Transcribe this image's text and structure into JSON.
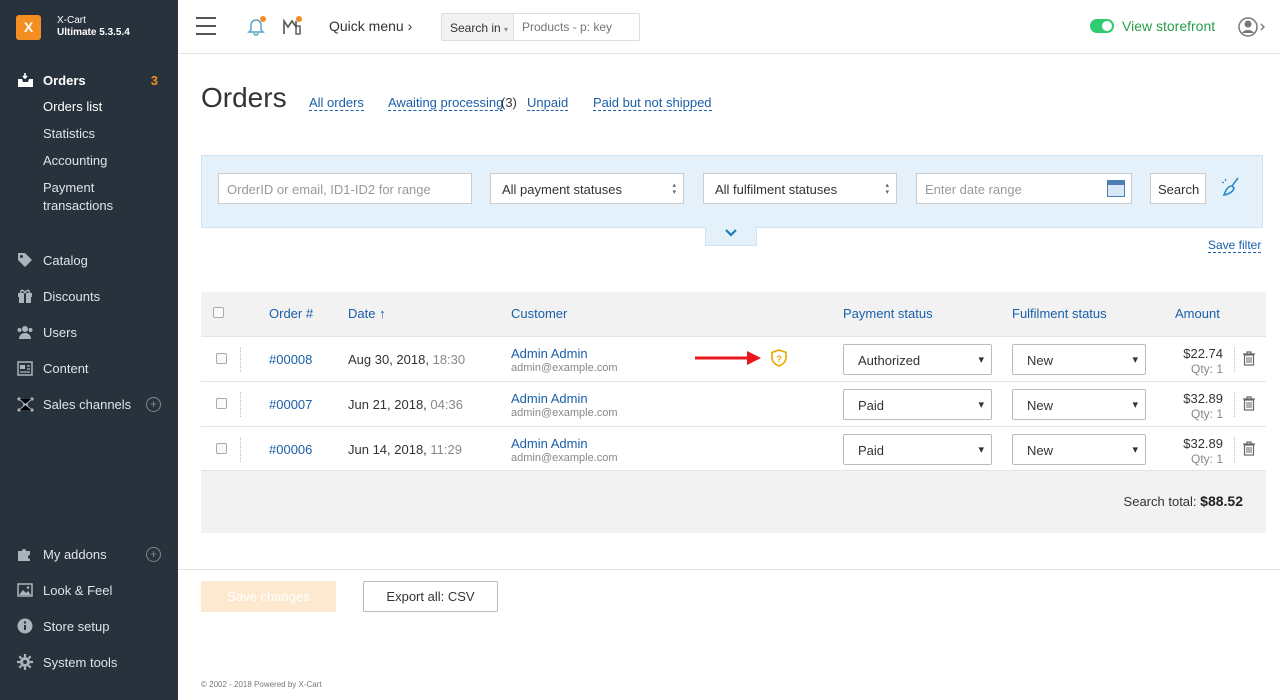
{
  "brand": {
    "line1": "X-Cart",
    "line2": "Ultimate 5.3.5.4",
    "logo_glyph": "X"
  },
  "sidebar": {
    "orders": {
      "label": "Orders",
      "badge": "3"
    },
    "orders_sub": [
      "Orders list",
      "Statistics",
      "Accounting",
      "Payment transactions"
    ],
    "items": [
      {
        "label": "Catalog",
        "icon": "tag-icon"
      },
      {
        "label": "Discounts",
        "icon": "gift-icon"
      },
      {
        "label": "Users",
        "icon": "users-icon"
      },
      {
        "label": "Content",
        "icon": "content-icon"
      },
      {
        "label": "Sales channels",
        "icon": "network-icon"
      }
    ],
    "bottom_items": [
      {
        "label": "My addons",
        "icon": "puzzle-icon"
      },
      {
        "label": "Look & Feel",
        "icon": "image-icon"
      },
      {
        "label": "Store setup",
        "icon": "info-icon"
      },
      {
        "label": "System tools",
        "icon": "gear-icon"
      }
    ]
  },
  "topbar": {
    "quick_menu": "Quick menu",
    "search_in": "Search in",
    "search_placeholder": "Products - p: key",
    "view_storefront": "View storefront"
  },
  "page": {
    "title": "Orders",
    "quick_links": [
      "All orders",
      "Awaiting processing",
      "Unpaid",
      "Paid but not shipped"
    ],
    "awaiting_count": "(3)"
  },
  "filter": {
    "order_placeholder": "OrderID or email, ID1-ID2 for range",
    "payment_status": "All payment statuses",
    "fulfilment_status": "All fulfilment statuses",
    "date_placeholder": "Enter date range",
    "search_label": "Search",
    "save_filter": "Save filter"
  },
  "table": {
    "headers": {
      "order": "Order #",
      "date": "Date ↑",
      "customer": "Customer",
      "payment": "Payment status",
      "fulfilment": "Fulfilment status",
      "amount": "Amount"
    },
    "rows": [
      {
        "order": "#00008",
        "date": "Aug 30, 2018,",
        "time": "18:30",
        "name": "Admin Admin",
        "email": "admin@example.com",
        "payment": "Authorized",
        "fulfilment": "New",
        "amount": "$22.74",
        "qty": "Qty: 1"
      },
      {
        "order": "#00007",
        "date": "Jun 21, 2018,",
        "time": "04:36",
        "name": "Admin Admin",
        "email": "admin@example.com",
        "payment": "Paid",
        "fulfilment": "New",
        "amount": "$32.89",
        "qty": "Qty: 1"
      },
      {
        "order": "#00006",
        "date": "Jun 14, 2018,",
        "time": "11:29",
        "name": "Admin Admin",
        "email": "admin@example.com",
        "payment": "Paid",
        "fulfilment": "New",
        "amount": "$32.89",
        "qty": "Qty: 1"
      }
    ],
    "total_label": "Search total:",
    "total_value": "$88.52"
  },
  "actions": {
    "save": "Save changes",
    "export": "Export all: CSV"
  },
  "footer": "© 2002 - 2018 Powered by X-Cart",
  "colors": {
    "sidebar_bg": "#27323c",
    "accent": "#f48e22",
    "link": "#1a5fa8",
    "storefront": "#2a9d4a",
    "filter_bg": "#e4f1fb",
    "arrow": "#e8171b",
    "shield": "#e8a800"
  }
}
